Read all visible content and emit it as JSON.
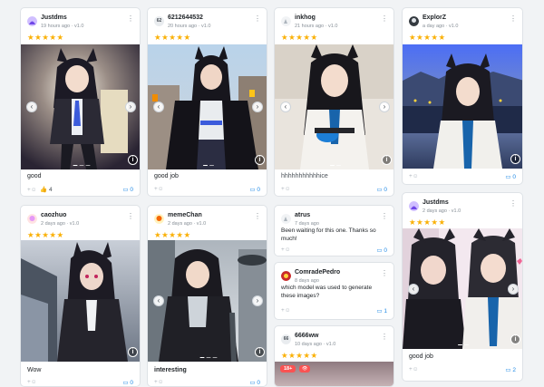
{
  "stars": "★★★★★",
  "ui": {
    "react_icon": "+☺",
    "comment_icon": "▭",
    "prev_arrow": "‹",
    "next_arrow": "›",
    "info_icon": "i",
    "kebab": "⋮"
  },
  "colors": {
    "accent": "#228be6",
    "star": "#fab005",
    "nsfw": "#fa5252"
  },
  "cards": [
    {
      "user": "Justdms",
      "meta": "19 hours ago · v1.0",
      "caption": "good",
      "reaction_count": "4",
      "comments": "0"
    },
    {
      "user": "6212644532",
      "avatar_text": "62",
      "meta": "20 hours ago · v1.0",
      "caption": "good job",
      "comments": "0"
    },
    {
      "user": "inkhog",
      "meta": "21 hours ago · v1.0",
      "caption": "hhhhhhhhhhhice",
      "comments": "0"
    },
    {
      "user": "ExplorZ",
      "meta": "a day ago · v1.0",
      "caption": "",
      "comments": "0"
    },
    {
      "user": "caozhuo",
      "meta": "2 days ago · v1.0",
      "caption": "Wow",
      "comments": "0"
    },
    {
      "user": "memeChan",
      "meta": "2 days ago · v1.0",
      "caption": "interesting",
      "comments": "0"
    },
    {
      "user": "atrus",
      "meta": "7 days ago",
      "text": "Been waiting for this one. Thanks so much!",
      "comments": "0"
    },
    {
      "user": "ComradePedro",
      "meta": "8 days ago",
      "text": "which model was used to generate these images?",
      "comments": "1"
    },
    {
      "user": "6666ww",
      "avatar_text": "66",
      "meta": "10 days ago · v1.0",
      "badge": "18+",
      "eye": "👁"
    },
    {
      "user": "Justdms",
      "meta": "2 days ago · v1.0",
      "caption": "good job",
      "comments": "2"
    }
  ]
}
